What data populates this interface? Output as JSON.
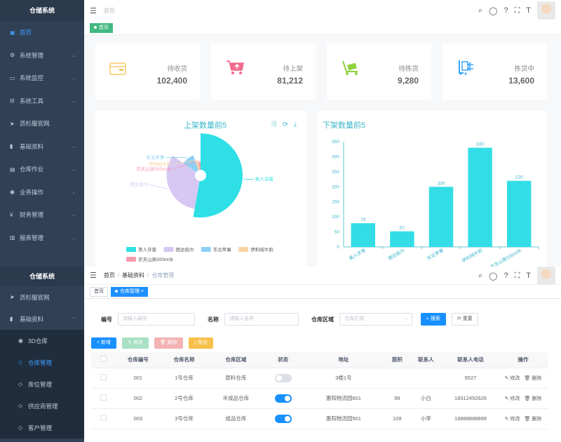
{
  "top": {
    "sidebar": {
      "logo": "仓储系统",
      "items": [
        {
          "label": "首页",
          "icon": "dashboard-icon",
          "active": true
        },
        {
          "label": "系统管理",
          "icon": "gear-icon",
          "chevron": true
        },
        {
          "label": "系统监控",
          "icon": "monitor-icon",
          "chevron": true
        },
        {
          "label": "系统工具",
          "icon": "toolbox-icon",
          "chevron": true
        },
        {
          "label": "沥杉服官网",
          "icon": "send-icon"
        },
        {
          "label": "基础资料",
          "icon": "book-icon",
          "chevron": true
        },
        {
          "label": "仓库作业",
          "icon": "clipboard-icon",
          "chevron": true
        },
        {
          "label": "业务操作",
          "icon": "globe-icon",
          "chevron": true
        },
        {
          "label": "财务管理",
          "icon": "yen-icon",
          "chevron": true
        },
        {
          "label": "报表管理",
          "icon": "bar-chart-icon",
          "chevron": true
        }
      ]
    },
    "breadcrumb": "首页",
    "tag": "首页",
    "cards": [
      {
        "label": "待收货",
        "value": "102,400",
        "icon": "wallet-icon",
        "color": "#f5c86a"
      },
      {
        "label": "待上架",
        "value": "81,212",
        "icon": "cart-icon",
        "color": "#f06b8b"
      },
      {
        "label": "待拣货",
        "value": "9,280",
        "icon": "trolley-icon",
        "color": "#8fd23f"
      },
      {
        "label": "拣货中",
        "value": "13,600",
        "icon": "forklift-icon",
        "color": "#36a3f7"
      }
    ],
    "pie": {
      "title": "上架数量前5",
      "tools": "🗎 ⟳ ⤓",
      "chart_data": {
        "type": "pie",
        "title": "上架数量前5",
        "slices": [
          {
            "name": "美人牙膏",
            "value": 330,
            "color": "#2ee0e6"
          },
          {
            "name": "德达纸巾",
            "value": 200,
            "color": "#d6c8f3"
          },
          {
            "name": "东北苹果",
            "value": 60,
            "color": "#8ed0f5"
          },
          {
            "name": "伊利纯牛奶",
            "value": 20,
            "color": "#f7d2a2"
          },
          {
            "name": "农夫山泉500ml水",
            "value": 15,
            "color": "#f59bb0"
          }
        ],
        "legend": "bottom"
      }
    },
    "bar": {
      "title": "下架数量前5",
      "chart_data": {
        "type": "bar",
        "title": "下架数量前5",
        "categories": [
          "美人牙膏",
          "德达纸巾",
          "东北苹果",
          "伊利纯牛奶",
          "农夫山泉500ml水"
        ],
        "values": [
          79,
          52,
          200,
          330,
          220
        ],
        "ylim": [
          0,
          350
        ],
        "yticks": [
          "0",
          "50",
          "100",
          "150",
          "200",
          "250",
          "300",
          "350"
        ],
        "color": "#33dde6"
      }
    }
  },
  "bottom": {
    "sidebar": {
      "logo": "仓储系统",
      "items": [
        {
          "label": "沥杉服官网",
          "icon": "send-icon",
          "sub": false
        },
        {
          "label": "基础资料",
          "icon": "book-icon",
          "sub": false,
          "chevron": "⌃"
        },
        {
          "label": "3D仓库",
          "icon": "globe-icon",
          "sub": true
        },
        {
          "label": "仓库管理",
          "icon": "cube-icon",
          "sub": true,
          "active": true
        },
        {
          "label": "库位管理",
          "icon": "cube-icon",
          "sub": true
        },
        {
          "label": "供应商管理",
          "icon": "cube-icon",
          "sub": true
        },
        {
          "label": "客户管理",
          "icon": "cube-icon",
          "sub": true
        }
      ]
    },
    "breadcrumb": [
      "首页",
      "基础资料",
      "仓库管理"
    ],
    "tags": [
      {
        "label": "首页",
        "active": false
      },
      {
        "label": "仓库管理",
        "active": true
      }
    ],
    "form": {
      "code_label": "编号",
      "code_placeholder": "请输入编号",
      "name_label": "名称",
      "name_placeholder": "请输入名称",
      "area_label": "仓库区域",
      "area_placeholder": "仓库区域",
      "search": "搜索",
      "reset": "重置"
    },
    "toolbar": {
      "add": "新增",
      "edit": "修改",
      "delete": "删除",
      "export": "导出"
    },
    "table": {
      "headers": [
        "",
        "仓库编号",
        "仓库名称",
        "仓库区域",
        "状态",
        "地址",
        "面积",
        "联系人",
        "联系人电话",
        "操作"
      ],
      "rows": [
        {
          "code": "001",
          "name": "1号仓库",
          "area": "原料仓库",
          "enabled": false,
          "address": "3楼1号",
          "size": "",
          "contact": "",
          "phone": "9527"
        },
        {
          "code": "002",
          "name": "2号仓库",
          "area": "半成品仓库",
          "enabled": true,
          "address": "惠阳物流园601",
          "size": "99",
          "contact": "小白",
          "phone": "18312492626"
        },
        {
          "code": "003",
          "name": "3号仓库",
          "area": "成品仓库",
          "enabled": true,
          "address": "惠阳物流园501",
          "size": "109",
          "contact": "小李",
          "phone": "18888888888"
        }
      ],
      "op_edit": "修改",
      "op_delete": "删除"
    }
  }
}
